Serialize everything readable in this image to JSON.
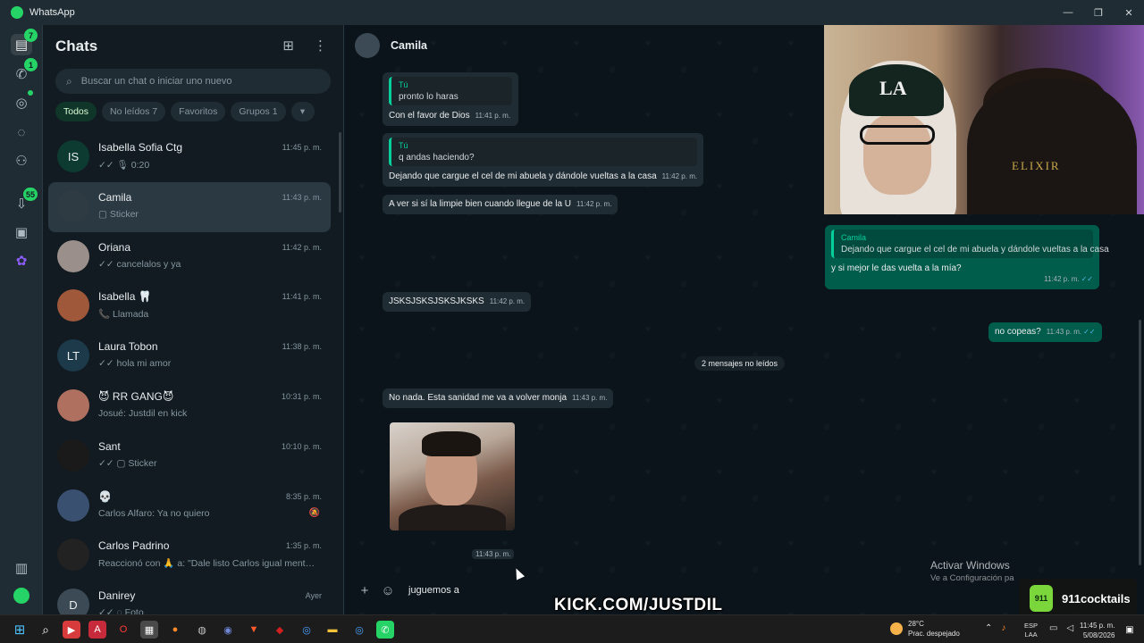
{
  "window": {
    "title": "WhatsApp",
    "controls": [
      "—",
      "❐",
      "✕"
    ]
  },
  "rail": {
    "chats_badge": "7",
    "calls_badge": "1",
    "archived_badge": "55"
  },
  "sidebar": {
    "title": "Chats",
    "search_placeholder": "Buscar un chat o iniciar uno nuevo",
    "filters": [
      {
        "label": "Todos"
      },
      {
        "label": "No leídos 7"
      },
      {
        "label": "Favoritos"
      },
      {
        "label": "Grupos 1"
      }
    ],
    "chats": [
      {
        "name": "Isabella Sofia Ctg",
        "time": "11:45 p. m.",
        "preview": "✓✓ 🎙 0:20",
        "initials": "IS",
        "avatar_color": "#0d3b32"
      },
      {
        "name": "Camila",
        "time": "11:43 p. m.",
        "preview": "▢ Sticker",
        "initials": "",
        "avatar_color": "#2f3b42"
      },
      {
        "name": "Oriana",
        "time": "11:42 p. m.",
        "preview": "✓✓ cancelalos y ya",
        "initials": "",
        "avatar_color": "#9a8f8a"
      },
      {
        "name": "Isabella 🦷",
        "time": "11:41 p. m.",
        "preview": "📞 Llamada",
        "initials": "",
        "avatar_color": "#a0583a"
      },
      {
        "name": "Laura Tobon",
        "time": "11:38 p. m.",
        "preview": "✓✓ hola mi amor",
        "initials": "LT",
        "avatar_color": "#1c3a4a"
      },
      {
        "name": "😈 RR GANG😈",
        "time": "10:31 p. m.",
        "preview": "Josué: Justdil en kick",
        "initials": "",
        "avatar_color": "#b07060"
      },
      {
        "name": "Sant",
        "time": "10:10 p. m.",
        "preview": "✓✓ ▢ Sticker",
        "initials": "",
        "avatar_color": "#1a1a1a"
      },
      {
        "name": "💀",
        "time": "8:35 p. m.",
        "preview": "Carlos Alfaro: Ya no quiero",
        "initials": "",
        "avatar_color": "#3a5070"
      },
      {
        "name": "Carlos Padrino",
        "time": "1:35 p. m.",
        "preview": "Reaccionó con 🙏 a: \"Dale listo Carlos igual mente ...",
        "initials": "",
        "avatar_color": "#222"
      },
      {
        "name": "Danirey",
        "time": "Ayer",
        "preview": "✓✓ ◌ Foto",
        "initials": "D",
        "avatar_color": "#3b4a54"
      }
    ]
  },
  "conversation": {
    "contact_name": "Camila",
    "messages": [
      {
        "quote_author": "Tú",
        "quote_text": "pronto lo haras",
        "text": "Con el favor de Dios",
        "time": "11:41 p. m."
      },
      {
        "quote_author": "Tú",
        "quote_text": "q andas haciendo?",
        "text": "Dejando que cargue el cel de mi abuela y dándole vueltas a la casa",
        "time": "11:42 p. m."
      },
      {
        "text": "A ver si sí la limpie bien cuando llegue de la U",
        "time": "11:42 p. m."
      },
      {
        "quote_author": "Camila",
        "quote_text": "Dejando que cargue el cel de mi abuela y dándole vueltas a la casa",
        "text": "y si mejor le das vuelta a la mía?",
        "time": "11:42 p. m."
      },
      {
        "text": "JSKSJSKSJSKSJKSKS",
        "time": "11:42 p. m."
      },
      {
        "text": "no copeas?",
        "time": "11:43 p. m."
      },
      {
        "text": "No nada. Esta sanidad me va a volver monja",
        "time": "11:43 p. m."
      }
    ],
    "unread_divider": "2 mensajes no leídos",
    "image_time": "11:43 p. m.",
    "composer_text": "juguemos a"
  },
  "overlay": {
    "activate_title": "Activar Windows",
    "activate_sub": "Ve a Configuración pa",
    "kick_text": "KICK.COM/JUSTDIL",
    "sponsor": "911cocktails",
    "sponsor_badge": "911",
    "webcam_cap_text": "LA",
    "webcam_shirt_text": "ELIXIR"
  },
  "taskbar": {
    "weather_temp": "28°C",
    "weather_desc": "Prac. despejado",
    "lang1": "ESP",
    "lang2": "LAA",
    "time": "11:45 p. m.",
    "date": "5/08/2026"
  }
}
